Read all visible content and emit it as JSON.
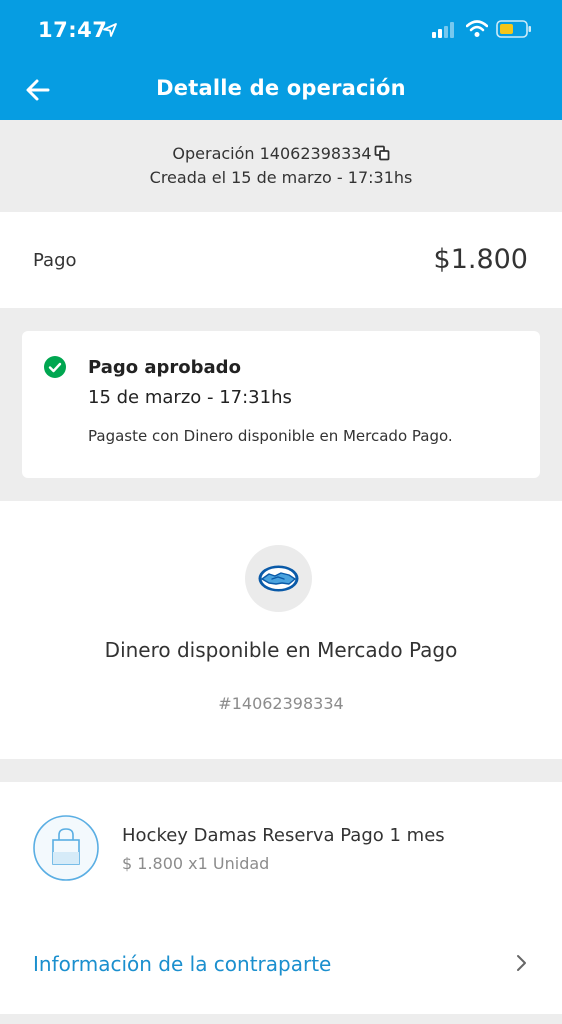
{
  "status_bar": {
    "time": "17:47"
  },
  "header": {
    "title": "Detalle de operación"
  },
  "operation": {
    "number_line": "Operación 14062398334",
    "created_line": "Creada el 15 de marzo - 17:31hs"
  },
  "payment": {
    "label": "Pago",
    "amount": "$1.800"
  },
  "status_card": {
    "title": "Pago aprobado",
    "date": "15 de marzo - 17:31hs",
    "description": "Pagaste con Dinero disponible en Mercado Pago."
  },
  "method": {
    "name": "Dinero disponible en Mercado Pago",
    "reference": "#14062398334"
  },
  "item": {
    "title": "Hockey Damas Reserva Pago 1 mes",
    "subtitle": "$ 1.800 x1 Unidad"
  },
  "counterpart": {
    "link_label": "Información de la contraparte"
  },
  "colors": {
    "header_bg": "#069de2",
    "link": "#1b8fce",
    "success": "#00a650",
    "battery": "#f5c518"
  }
}
